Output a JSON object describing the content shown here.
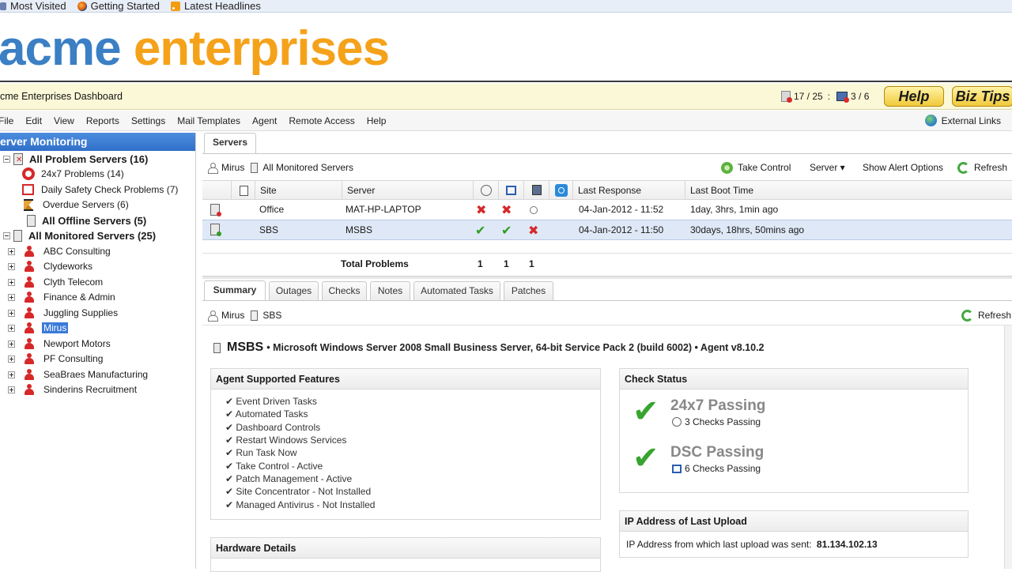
{
  "bookmarks": [
    {
      "label": "Most Visited",
      "icon": "bookmark-icon"
    },
    {
      "label": "Getting Started",
      "icon": "firefox-icon"
    },
    {
      "label": "Latest Headlines",
      "icon": "rss-icon"
    }
  ],
  "logo": {
    "acme": "acme",
    "enterprises": "enterprises"
  },
  "titlebar": {
    "title": "cme Enterprises Dashboard",
    "problem_count": "17 / 25",
    "separator": ":",
    "offline_count": "3 / 6",
    "help_label": "Help",
    "biztips_label": "Biz Tips"
  },
  "menu": [
    "File",
    "Edit",
    "View",
    "Reports",
    "Settings",
    "Mail Templates",
    "Agent",
    "Remote Access",
    "Help"
  ],
  "external_links": "External Links",
  "tree": {
    "header": "erver Monitoring",
    "problem_servers": "All Problem Servers (16)",
    "p24x7": "24x7 Problems (14)",
    "dsc": "Daily Safety Check Problems (7)",
    "overdue": "Overdue Servers (6)",
    "offline": "All Offline Servers (5)",
    "monitored": "All Monitored Servers (25)",
    "clients": [
      "ABC Consulting",
      "Clydeworks",
      "Clyth Telecom",
      "Finance & Admin",
      "Juggling Supplies",
      "Mirus",
      "Newport Motors",
      "PF Consulting",
      "SeaBraes Manufacturing",
      "Sinderins Recruitment"
    ]
  },
  "servers_tab": "Servers",
  "servers_toolbar": {
    "client": "Mirus",
    "scope": "All Monitored Servers",
    "take_control": "Take Control",
    "server_menu": "Server ▾",
    "show_alert": "Show Alert Options",
    "refresh": "Refresh"
  },
  "grid": {
    "headers": {
      "site": "Site",
      "server": "Server",
      "last_response": "Last Response",
      "last_boot": "Last Boot Time"
    },
    "rows": [
      {
        "site": "Office",
        "server": "MAT-HP-LAPTOP",
        "last_response": "04-Jan-2012 - 11:52",
        "last_boot": "1day, 3hrs, 1min ago"
      },
      {
        "site": "SBS",
        "server": "MSBS",
        "last_response": "04-Jan-2012 - 11:50",
        "last_boot": "30days, 18hrs, 50mins ago"
      }
    ],
    "total_label": "Total Problems",
    "totals": [
      "1",
      "1",
      "1"
    ]
  },
  "detail_tabs": [
    "Summary",
    "Outages",
    "Checks",
    "Notes",
    "Automated Tasks",
    "Patches"
  ],
  "detail_toolbar": {
    "client": "Mirus",
    "server": "SBS",
    "refresh": "Refresh"
  },
  "server_header": {
    "name": "MSBS",
    "desc": "• Microsoft Windows Server 2008 Small Business Server, 64-bit Service Pack 2 (build 6002) • Agent v8.10.2"
  },
  "features": {
    "title": "Agent Supported Features",
    "items": [
      "✔ Event Driven Tasks",
      "✔ Automated Tasks",
      "✔ Dashboard Controls",
      "✔ Restart Windows Services",
      "✔ Run Task Now",
      "✔ Take Control - Active",
      "✔ Patch Management - Active",
      "✔ Site Concentrator - Not Installed",
      "✔ Managed Antivirus - Not Installed"
    ]
  },
  "hardware": {
    "title": "Hardware Details"
  },
  "check_status": {
    "title": "Check Status",
    "p24": "24x7 Passing",
    "p24_sub": "3 Checks Passing",
    "dsc": "DSC Passing",
    "dsc_sub": "6 Checks Passing"
  },
  "ip": {
    "title": "IP Address of Last Upload",
    "label": "IP Address from which last upload was sent:",
    "value": "81.134.102.13"
  },
  "colors": {
    "acme_blue": "#3b7fc4",
    "acme_orange": "#f5a21b",
    "tree_header": "#2f6fc8",
    "fail": "#d62828",
    "pass": "#2f9e22"
  }
}
